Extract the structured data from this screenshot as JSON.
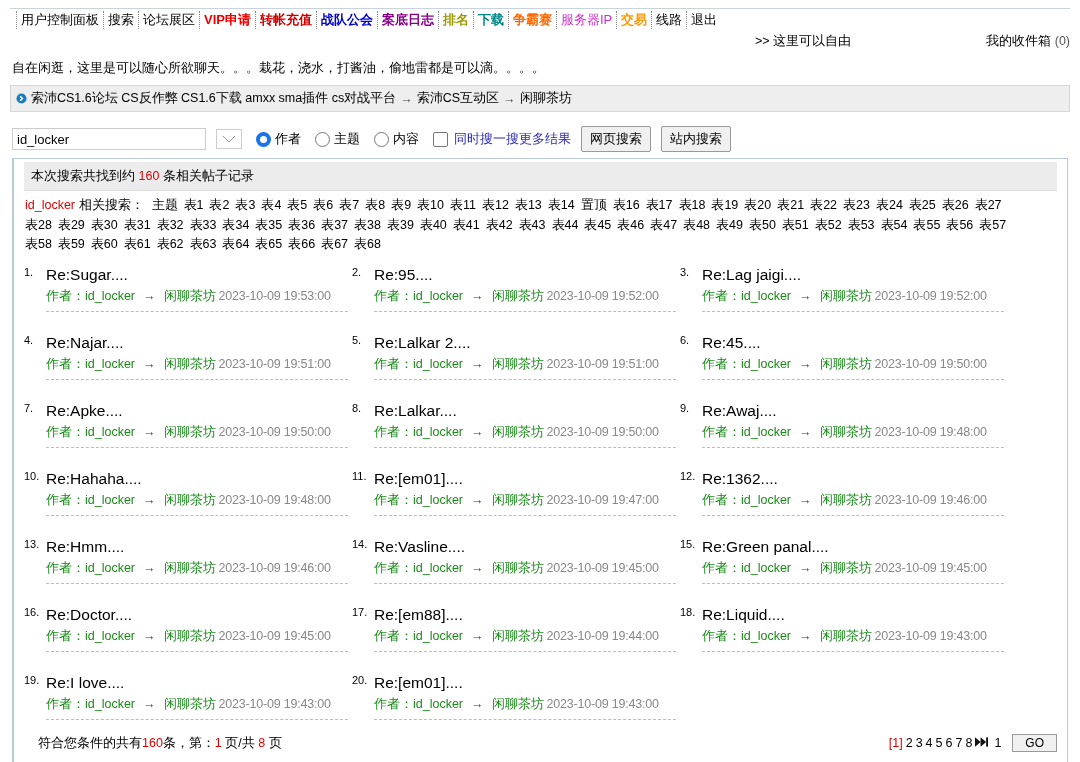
{
  "nav": [
    {
      "label": "用户控制面板",
      "bold": false
    },
    {
      "label": "搜索",
      "bold": false
    },
    {
      "label": "论坛展区",
      "bold": false
    },
    {
      "label": "VIP申请",
      "color": "#ee0000",
      "bold": true
    },
    {
      "label": "转帐充值",
      "color": "#cc0000",
      "bold": true
    },
    {
      "label": "战队公会",
      "color": "#0000cc",
      "bold": true
    },
    {
      "label": "案底日志",
      "color": "#880088",
      "bold": true
    },
    {
      "label": "排名",
      "color": "#999900",
      "bold": true
    },
    {
      "label": "下载",
      "color": "#008888",
      "bold": true
    },
    {
      "label": "争霸赛",
      "color": "#ff6600",
      "bold": true
    },
    {
      "label": "服务器IP",
      "color": "#cc33cc",
      "bold": false
    },
    {
      "label": "交易",
      "color": "#ff9900",
      "bold": true
    },
    {
      "label": "线路",
      "bold": false
    },
    {
      "label": "退出",
      "bold": false
    }
  ],
  "marquee": ">> 这里可以自由",
  "inbox": {
    "label": "我的收件箱",
    "count": "(0)"
  },
  "intro": "自在闲逛，这里是可以随心所欲聊天。。。栽花，浇水，打酱油，偷地雷都是可以滴。。。。",
  "breadcrumb": [
    "索沛CS1.6论坛 CS反作弊 CS1.6下载 amxx sma插件 cs对战平台",
    "→",
    "索沛CS互动区",
    "→",
    "闲聊茶坊"
  ],
  "search": {
    "value": "id_locker",
    "options": [
      {
        "label": "作者",
        "selected": true
      },
      {
        "label": "主题",
        "selected": false
      },
      {
        "label": "内容",
        "selected": false
      }
    ],
    "more": {
      "label": "同时搜一搜更多结果",
      "checked": false
    },
    "buttons": [
      "网页搜索",
      "站内搜索"
    ]
  },
  "summary": [
    {
      "text": "本次搜索共找到约 ",
      "highlight": false
    },
    {
      "text": "160",
      "highlight": true
    },
    {
      "text": " 条相关帖子记录",
      "highlight": false
    }
  ],
  "related": {
    "keyword": "id_locker",
    "label": "相关搜索：",
    "tags": [
      "主题",
      "表1",
      "表2",
      "表3",
      "表4",
      "表5",
      "表6",
      "表7",
      "表8",
      "表9",
      "表10",
      "表11",
      "表12",
      "表13",
      "表14",
      "置顶",
      "表16",
      "表17",
      "表18",
      "表19",
      "表20",
      "表21",
      "表22",
      "表23",
      "表24",
      "表25",
      "表26",
      "表27",
      "表28",
      "表29",
      "表30",
      "表31",
      "表32",
      "表33",
      "表34",
      "表35",
      "表36",
      "表37",
      "表38",
      "表39",
      "表40",
      "表41",
      "表42",
      "表43",
      "表44",
      "表45",
      "表46",
      "表47",
      "表48",
      "表49",
      "表50",
      "表51",
      "表52",
      "表53",
      "表54",
      "表55",
      "表56",
      "表57",
      "表58",
      "表59",
      "表60",
      "表61",
      "表62",
      "表63",
      "表64",
      "表65",
      "表66",
      "表67",
      "表68"
    ]
  },
  "results": [
    {
      "number": "1.",
      "title": "Re:Sugar....",
      "author_label": "作者：",
      "author": "id_locker",
      "arrow": "→",
      "forum": "闲聊茶坊",
      "time": "2023-10-09 19:53:00"
    },
    {
      "number": "2.",
      "title": "Re:95....",
      "author_label": "作者：",
      "author": "id_locker",
      "arrow": "→",
      "forum": "闲聊茶坊",
      "time": "2023-10-09 19:52:00"
    },
    {
      "number": "3.",
      "title": "Re:Lag jaigi....",
      "author_label": "作者：",
      "author": "id_locker",
      "arrow": "→",
      "forum": "闲聊茶坊",
      "time": "2023-10-09 19:52:00"
    },
    {
      "number": "4.",
      "title": "Re:Najar....",
      "author_label": "作者：",
      "author": "id_locker",
      "arrow": "→",
      "forum": "闲聊茶坊",
      "time": "2023-10-09 19:51:00"
    },
    {
      "number": "5.",
      "title": "Re:Lalkar 2....",
      "author_label": "作者：",
      "author": "id_locker",
      "arrow": "→",
      "forum": "闲聊茶坊",
      "time": "2023-10-09 19:51:00"
    },
    {
      "number": "6.",
      "title": "Re:45....",
      "author_label": "作者：",
      "author": "id_locker",
      "arrow": "→",
      "forum": "闲聊茶坊",
      "time": "2023-10-09 19:50:00"
    },
    {
      "number": "7.",
      "title": "Re:Apke....",
      "author_label": "作者：",
      "author": "id_locker",
      "arrow": "→",
      "forum": "闲聊茶坊",
      "time": "2023-10-09 19:50:00"
    },
    {
      "number": "8.",
      "title": "Re:Lalkar....",
      "author_label": "作者：",
      "author": "id_locker",
      "arrow": "→",
      "forum": "闲聊茶坊",
      "time": "2023-10-09 19:50:00"
    },
    {
      "number": "9.",
      "title": "Re:Awaj....",
      "author_label": "作者：",
      "author": "id_locker",
      "arrow": "→",
      "forum": "闲聊茶坊",
      "time": "2023-10-09 19:48:00"
    },
    {
      "number": "10.",
      "title": "Re:Hahaha....",
      "author_label": "作者：",
      "author": "id_locker",
      "arrow": "→",
      "forum": "闲聊茶坊",
      "time": "2023-10-09 19:48:00"
    },
    {
      "number": "11.",
      "title": "Re:[em01]....",
      "author_label": "作者：",
      "author": "id_locker",
      "arrow": "→",
      "forum": "闲聊茶坊",
      "time": "2023-10-09 19:47:00"
    },
    {
      "number": "12.",
      "title": "Re:1362....",
      "author_label": "作者：",
      "author": "id_locker",
      "arrow": "→",
      "forum": "闲聊茶坊",
      "time": "2023-10-09 19:46:00"
    },
    {
      "number": "13.",
      "title": "Re:Hmm....",
      "author_label": "作者：",
      "author": "id_locker",
      "arrow": "→",
      "forum": "闲聊茶坊",
      "time": "2023-10-09 19:46:00"
    },
    {
      "number": "14.",
      "title": "Re:Vasline....",
      "author_label": "作者：",
      "author": "id_locker",
      "arrow": "→",
      "forum": "闲聊茶坊",
      "time": "2023-10-09 19:45:00"
    },
    {
      "number": "15.",
      "title": "Re:Green panal....",
      "author_label": "作者：",
      "author": "id_locker",
      "arrow": "→",
      "forum": "闲聊茶坊",
      "time": "2023-10-09 19:45:00"
    },
    {
      "number": "16.",
      "title": "Re:Doctor....",
      "author_label": "作者：",
      "author": "id_locker",
      "arrow": "→",
      "forum": "闲聊茶坊",
      "time": "2023-10-09 19:45:00"
    },
    {
      "number": "17.",
      "title": "Re:[em88]....",
      "author_label": "作者：",
      "author": "id_locker",
      "arrow": "→",
      "forum": "闲聊茶坊",
      "time": "2023-10-09 19:44:00"
    },
    {
      "number": "18.",
      "title": "Re:Liquid....",
      "author_label": "作者：",
      "author": "id_locker",
      "arrow": "→",
      "forum": "闲聊茶坊",
      "time": "2023-10-09 19:43:00"
    },
    {
      "number": "19.",
      "title": "Re:I love....",
      "author_label": "作者：",
      "author": "id_locker",
      "arrow": "→",
      "forum": "闲聊茶坊",
      "time": "2023-10-09 19:43:00"
    },
    {
      "number": "20.",
      "title": "Re:[em01]....",
      "author_label": "作者：",
      "author": "id_locker",
      "arrow": "→",
      "forum": "闲聊茶坊",
      "time": "2023-10-09 19:43:00"
    }
  ],
  "footer": {
    "summary": [
      {
        "text": "符合您条件的共有",
        "highlight": false
      },
      {
        "text": "160",
        "highlight": true
      },
      {
        "text": "条，第：",
        "highlight": false
      },
      {
        "text": "1",
        "highlight": true
      },
      {
        "text": " 页/共 ",
        "highlight": false
      },
      {
        "text": "8",
        "highlight": true
      },
      {
        "text": " 页",
        "highlight": false
      }
    ],
    "pages": [
      {
        "label": "[1]",
        "selected": true
      },
      {
        "label": "2",
        "selected": false
      },
      {
        "label": "3",
        "selected": false
      },
      {
        "label": "4",
        "selected": false
      },
      {
        "label": "5",
        "selected": false
      },
      {
        "label": "6",
        "selected": false
      },
      {
        "label": "7",
        "selected": false
      },
      {
        "label": "8",
        "selected": false
      }
    ],
    "page_input": "1",
    "go": "GO"
  }
}
